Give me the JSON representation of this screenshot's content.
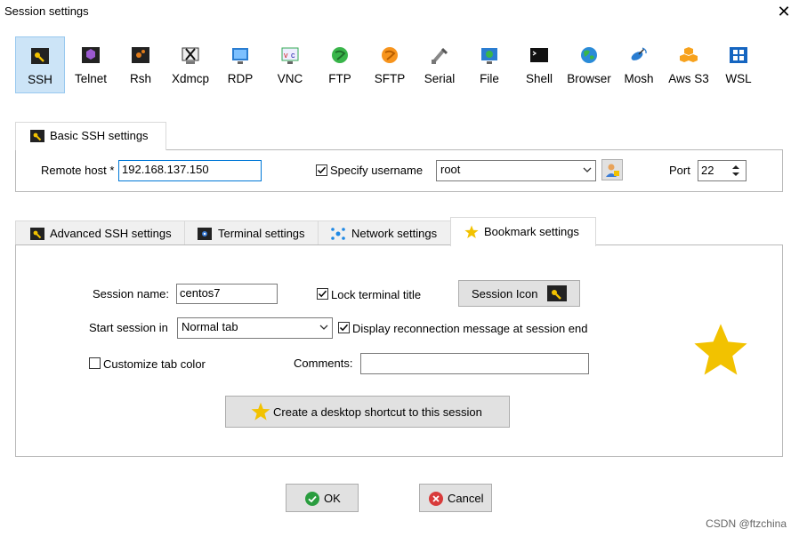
{
  "window": {
    "title": "Session settings",
    "close_glyph": "✕"
  },
  "protocols": [
    {
      "label": "SSH",
      "icon": "key-icon",
      "selected": true
    },
    {
      "label": "Telnet",
      "icon": "telnet-icon"
    },
    {
      "label": "Rsh",
      "icon": "rsh-icon"
    },
    {
      "label": "Xdmcp",
      "icon": "xdmcp-icon"
    },
    {
      "label": "RDP",
      "icon": "rdp-icon"
    },
    {
      "label": "VNC",
      "icon": "vnc-icon"
    },
    {
      "label": "FTP",
      "icon": "ftp-icon"
    },
    {
      "label": "SFTP",
      "icon": "sftp-icon"
    },
    {
      "label": "Serial",
      "icon": "serial-icon"
    },
    {
      "label": "File",
      "icon": "file-icon"
    },
    {
      "label": "Shell",
      "icon": "shell-icon"
    },
    {
      "label": "Browser",
      "icon": "globe-icon"
    },
    {
      "label": "Mosh",
      "icon": "satellite-icon"
    },
    {
      "label": "Aws S3",
      "icon": "aws-icon"
    },
    {
      "label": "WSL",
      "icon": "windows-icon"
    }
  ],
  "basic": {
    "tab_label": "Basic SSH settings",
    "remote_host_label": "Remote host *",
    "remote_host_value": "192.168.137.150",
    "specify_username_label": "Specify username",
    "specify_username_checked": true,
    "username_value": "root",
    "port_label": "Port",
    "port_value": "22"
  },
  "tabs": {
    "advanced": "Advanced SSH settings",
    "terminal": "Terminal settings",
    "network": "Network settings",
    "bookmark": "Bookmark settings",
    "active": "bookmark"
  },
  "bookmark": {
    "session_name_label": "Session name:",
    "session_name_value": "centos7",
    "lock_title_label": "Lock terminal title",
    "lock_title_checked": true,
    "session_icon_label": "Session Icon",
    "start_session_label": "Start session in",
    "start_session_value": "Normal tab",
    "display_reconnect_label": "Display reconnection message at session end",
    "display_reconnect_checked": true,
    "customize_color_label": "Customize tab color",
    "customize_color_checked": false,
    "comments_label": "Comments:",
    "comments_value": "",
    "shortcut_label": "Create a desktop shortcut to this session"
  },
  "buttons": {
    "ok": "OK",
    "cancel": "Cancel"
  },
  "watermark": "CSDN @ftzchina",
  "colors": {
    "accent": "#0078d7",
    "star": "#f2c200",
    "selected_bg": "#cce4f7",
    "ok_green": "#2a9d3f",
    "cancel_red": "#d83b3b"
  }
}
